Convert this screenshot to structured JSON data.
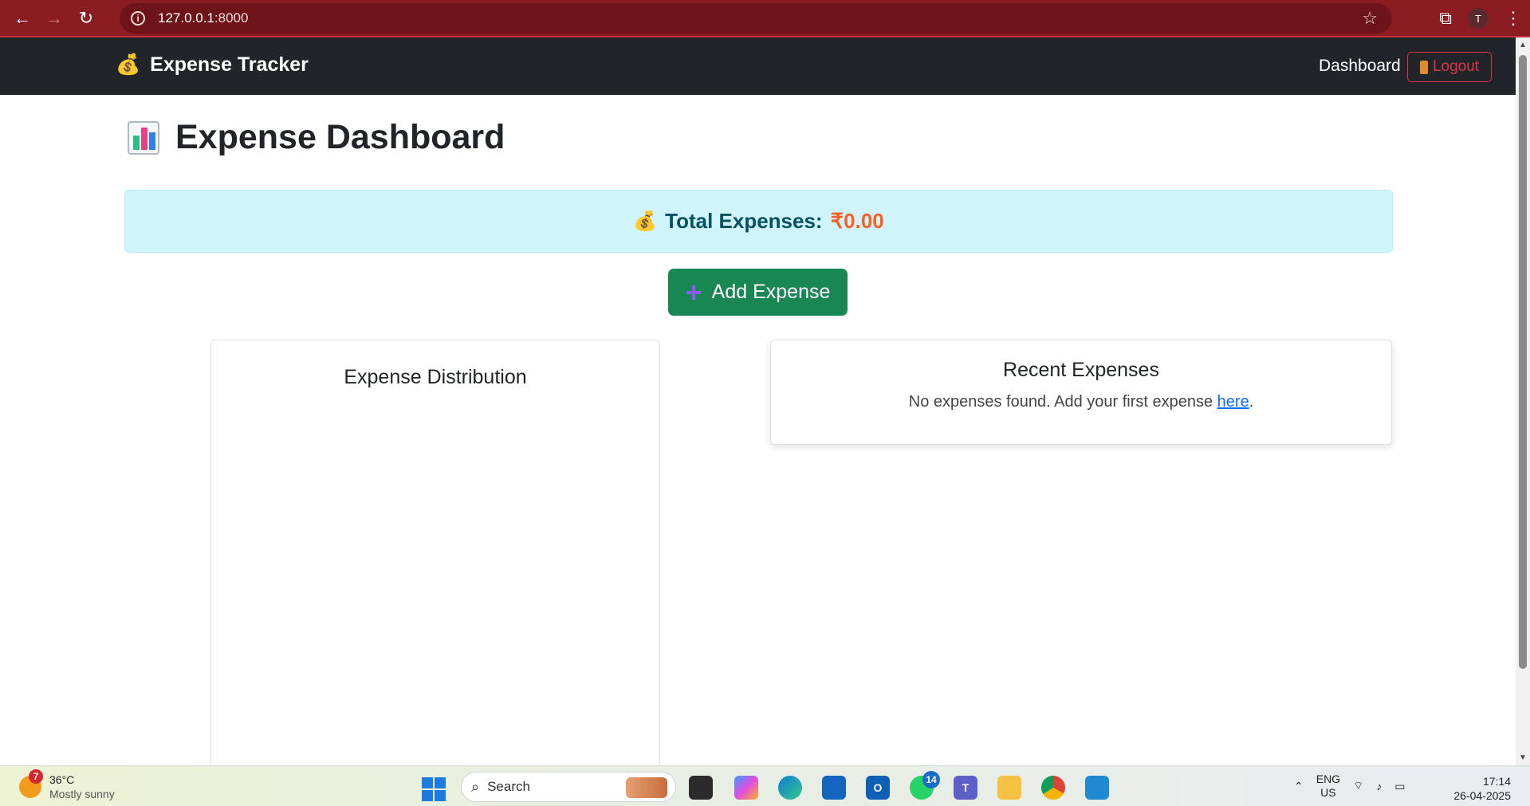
{
  "browser": {
    "url_host": "127.0.0.1",
    "url_port": ":8000",
    "profile_initial": "T"
  },
  "navbar": {
    "brand_icon": "💰",
    "brand": "Expense Tracker",
    "links": {
      "dashboard": "Dashboard",
      "logout": "Logout"
    }
  },
  "main": {
    "title": "Expense Dashboard",
    "total": {
      "label": "Total Expenses:",
      "amount": "₹0.00"
    },
    "add_button": "Add Expense",
    "distribution": {
      "title": "Expense Distribution"
    },
    "recent": {
      "title": "Recent Expenses",
      "empty_text": "No expenses found. Add your first expense ",
      "empty_link": "here",
      "empty_suffix": "."
    }
  },
  "taskbar": {
    "weather": {
      "badge": "7",
      "temp": "36°C",
      "condition": "Mostly sunny"
    },
    "search_placeholder": "Search",
    "whatsapp_badge": "14",
    "lang": {
      "line1": "ENG",
      "line2": "US"
    },
    "clock": {
      "time": "17:14",
      "date": "26-04-2025"
    }
  },
  "colors": {
    "browser_bar": "#8a1c22",
    "navbar": "#212529",
    "alert_bg": "#cff4fc",
    "amount": "#fd5e22",
    "add_button": "#198754",
    "logout": "#dc3545"
  }
}
